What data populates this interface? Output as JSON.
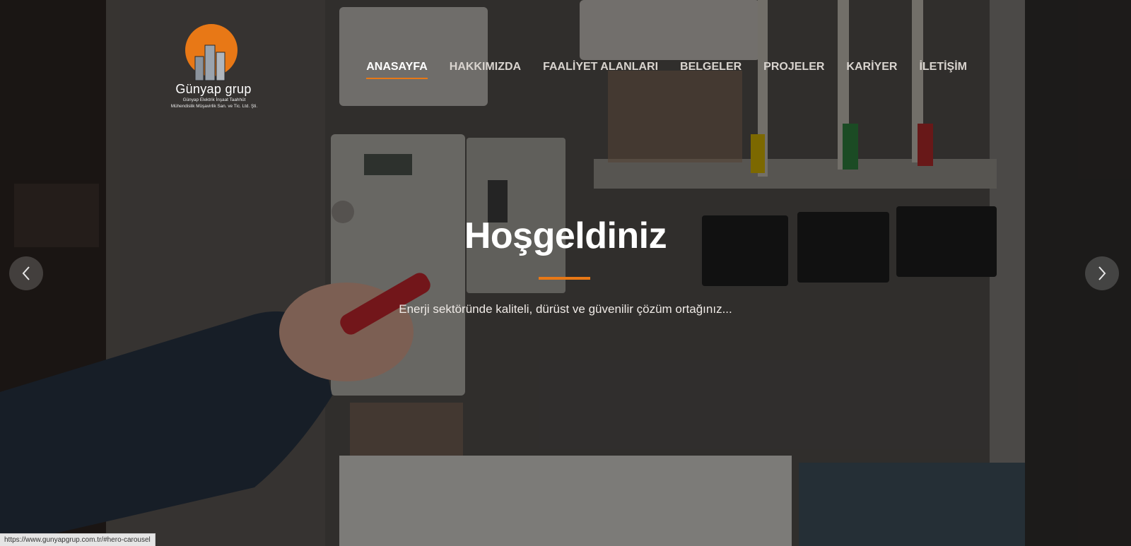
{
  "brand": {
    "name": "Günyap grup",
    "subline1": "Günyap Elektrik İnşaat Taahhüt",
    "subline2": "Mühendislik Müşavirlik San. ve Tic. Ltd. Şti.",
    "accent_color": "#e87816"
  },
  "nav": {
    "items": [
      {
        "label": "ANASAYFA",
        "active": true
      },
      {
        "label": "HAKKIMIZDA"
      },
      {
        "label": "FAALİYET ALANLARI"
      },
      {
        "label": "BELGELER"
      },
      {
        "label": "PROJELER"
      },
      {
        "label": "KARİYER"
      },
      {
        "label": "İLETİŞİM"
      }
    ]
  },
  "hero": {
    "title": "Hoşgeldiniz",
    "subtitle": "Enerji sektöründe kaliteli, dürüst ve güvenilir çözüm ortağınız...",
    "background_image": "electrician-hand-with-screwdriver-working-on-electrical-panel",
    "prev_icon": "chevron-left-icon",
    "next_icon": "chevron-right-icon"
  },
  "status_bar": {
    "url": "https://www.gunyapgrup.com.tr/#hero-carousel"
  }
}
